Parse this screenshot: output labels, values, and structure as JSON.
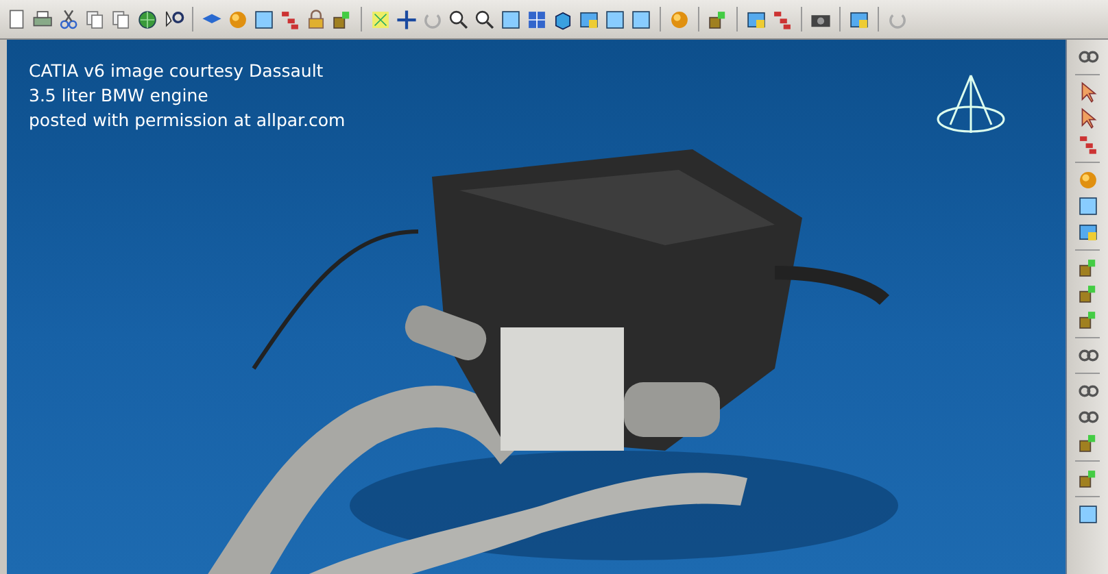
{
  "viewport": {
    "caption": [
      "CATIA v6 image courtesy Dassault",
      "3.5 liter BMW engine",
      "posted with permission at allpar.com"
    ]
  }
}
